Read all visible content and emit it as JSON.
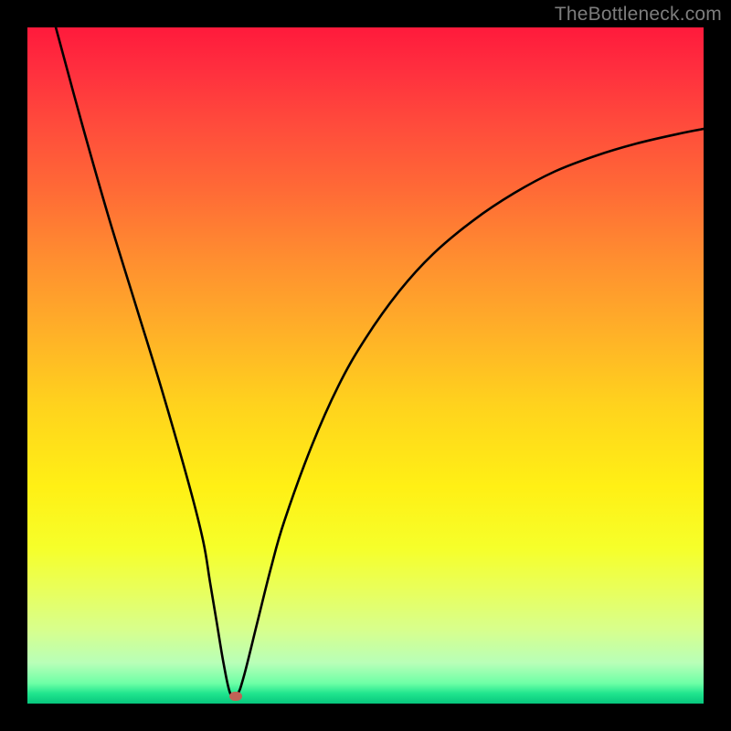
{
  "watermark": "TheBottleneck.com",
  "chart_data": {
    "type": "line",
    "title": "",
    "xlabel": "",
    "ylabel": "",
    "xlim": [
      0,
      100
    ],
    "ylim": [
      0,
      100
    ],
    "grid": false,
    "series": [
      {
        "name": "curve",
        "x": [
          4.2,
          8,
          12,
          16,
          20,
          24,
          26,
          27,
          28,
          29,
          30,
          31,
          32,
          34,
          36,
          38,
          42,
          46,
          50,
          55,
          60,
          66,
          72,
          78,
          84,
          90,
          96,
          100
        ],
        "y": [
          100,
          86,
          72,
          59,
          46,
          32,
          24,
          18,
          12,
          6,
          1.5,
          1.3,
          4,
          12,
          20,
          27,
          38,
          47,
          54,
          61,
          66.5,
          71.5,
          75.5,
          78.7,
          81.0,
          82.8,
          84.2,
          85.0
        ]
      }
    ],
    "marker": {
      "x": 30.8,
      "y": 1.1
    },
    "background_gradient": {
      "stops": [
        {
          "pct": 0,
          "color": "#ff1a3c"
        },
        {
          "pct": 34,
          "color": "#ff8d30"
        },
        {
          "pct": 68,
          "color": "#fff015"
        },
        {
          "pct": 94,
          "color": "#b8ffb8"
        },
        {
          "pct": 100,
          "color": "#07c77d"
        }
      ]
    }
  }
}
